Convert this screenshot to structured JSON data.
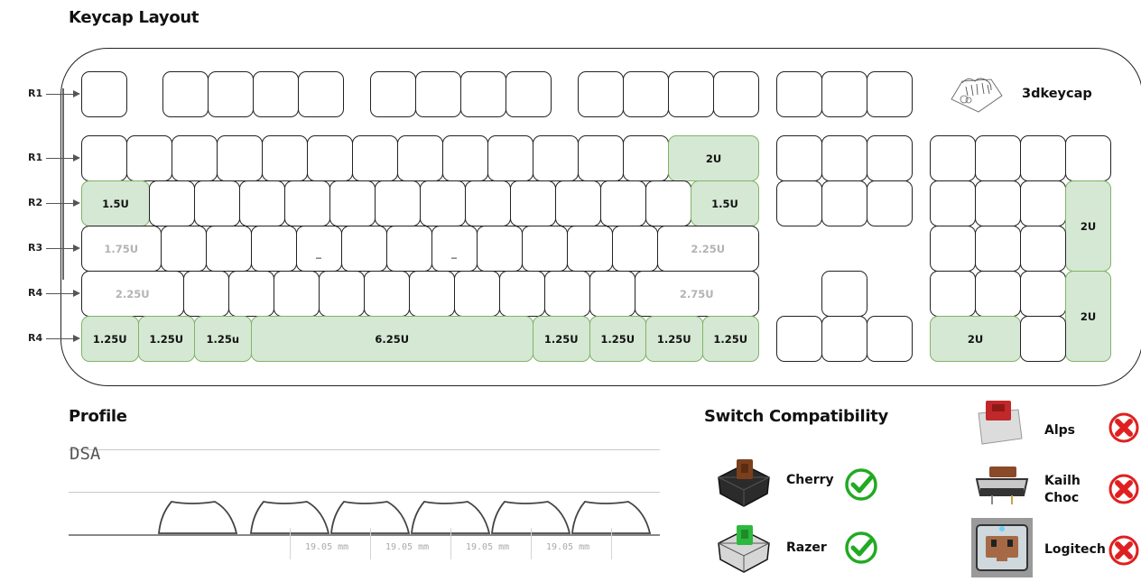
{
  "sections": {
    "layout_title": "Keycap Layout",
    "profile_title": "Profile",
    "switch_title": "Switch Compatibility"
  },
  "brand": {
    "name": "3dkeycap",
    "icon": "keycap-logo-icon"
  },
  "row_labels": [
    "R1",
    "R1",
    "R2",
    "R3",
    "R4",
    "R4"
  ],
  "keyboard": {
    "colors": {
      "highlight_fill": "#d5e8d4",
      "highlight_border": "#82b366",
      "dim_text": "#b3b3b3"
    },
    "rows": [
      {
        "row": "R1",
        "keys": [
          {
            "u": 1,
            "label": ""
          },
          {
            "gap": 0.8
          },
          {
            "u": 1,
            "label": ""
          },
          {
            "u": 1,
            "label": ""
          },
          {
            "u": 1,
            "label": ""
          },
          {
            "u": 1,
            "label": ""
          },
          {
            "gap": 0.6
          },
          {
            "u": 1,
            "label": ""
          },
          {
            "u": 1,
            "label": ""
          },
          {
            "u": 1,
            "label": ""
          },
          {
            "u": 1,
            "label": ""
          },
          {
            "gap": 0.6
          },
          {
            "u": 1,
            "label": ""
          },
          {
            "u": 1,
            "label": ""
          },
          {
            "u": 1,
            "label": ""
          },
          {
            "u": 1,
            "label": ""
          }
        ]
      },
      {
        "row": "R1",
        "keys": [
          {
            "u": 1,
            "label": ""
          },
          {
            "u": 1,
            "label": ""
          },
          {
            "u": 1,
            "label": ""
          },
          {
            "u": 1,
            "label": ""
          },
          {
            "u": 1,
            "label": ""
          },
          {
            "u": 1,
            "label": ""
          },
          {
            "u": 1,
            "label": ""
          },
          {
            "u": 1,
            "label": ""
          },
          {
            "u": 1,
            "label": ""
          },
          {
            "u": 1,
            "label": ""
          },
          {
            "u": 1,
            "label": ""
          },
          {
            "u": 1,
            "label": ""
          },
          {
            "u": 1,
            "label": ""
          },
          {
            "u": 2,
            "label": "2U",
            "hl": true
          }
        ]
      },
      {
        "row": "R2",
        "keys": [
          {
            "u": 1.5,
            "label": "1.5U",
            "hl": true
          },
          {
            "u": 1,
            "label": ""
          },
          {
            "u": 1,
            "label": ""
          },
          {
            "u": 1,
            "label": ""
          },
          {
            "u": 1,
            "label": ""
          },
          {
            "u": 1,
            "label": ""
          },
          {
            "u": 1,
            "label": ""
          },
          {
            "u": 1,
            "label": ""
          },
          {
            "u": 1,
            "label": ""
          },
          {
            "u": 1,
            "label": ""
          },
          {
            "u": 1,
            "label": ""
          },
          {
            "u": 1,
            "label": ""
          },
          {
            "u": 1,
            "label": ""
          },
          {
            "u": 1.5,
            "label": "1.5U",
            "hl": true
          }
        ]
      },
      {
        "row": "R3",
        "keys": [
          {
            "u": 1.75,
            "label": "1.75U",
            "dim": true
          },
          {
            "u": 1,
            "label": ""
          },
          {
            "u": 1,
            "label": ""
          },
          {
            "u": 1,
            "label": ""
          },
          {
            "u": 1,
            "label": "_"
          },
          {
            "u": 1,
            "label": ""
          },
          {
            "u": 1,
            "label": ""
          },
          {
            "u": 1,
            "label": "_"
          },
          {
            "u": 1,
            "label": ""
          },
          {
            "u": 1,
            "label": ""
          },
          {
            "u": 1,
            "label": ""
          },
          {
            "u": 1,
            "label": ""
          },
          {
            "u": 2.25,
            "label": "2.25U",
            "dim": true
          }
        ]
      },
      {
        "row": "R4",
        "keys": [
          {
            "u": 2.25,
            "label": "2.25U",
            "dim": true
          },
          {
            "u": 1,
            "label": ""
          },
          {
            "u": 1,
            "label": ""
          },
          {
            "u": 1,
            "label": ""
          },
          {
            "u": 1,
            "label": ""
          },
          {
            "u": 1,
            "label": ""
          },
          {
            "u": 1,
            "label": ""
          },
          {
            "u": 1,
            "label": ""
          },
          {
            "u": 1,
            "label": ""
          },
          {
            "u": 1,
            "label": ""
          },
          {
            "u": 1,
            "label": ""
          },
          {
            "u": 2.75,
            "label": "2.75U",
            "dim": true
          }
        ]
      },
      {
        "row": "R4",
        "keys": [
          {
            "u": 1.25,
            "label": "1.25U",
            "hl": true
          },
          {
            "u": 1.25,
            "label": "1.25U",
            "hl": true
          },
          {
            "u": 1.25,
            "label": "1.25u",
            "hl": true
          },
          {
            "u": 6.25,
            "label": "6.25U",
            "hl": true
          },
          {
            "u": 1.25,
            "label": "1.25U",
            "hl": true
          },
          {
            "u": 1.25,
            "label": "1.25U",
            "hl": true
          },
          {
            "u": 1.25,
            "label": "1.25U",
            "hl": true
          },
          {
            "u": 1.25,
            "label": "1.25U",
            "hl": true
          }
        ]
      }
    ],
    "nav_cluster": [
      {
        "col": 0,
        "row": 0,
        "label": ""
      },
      {
        "col": 1,
        "row": 0,
        "label": ""
      },
      {
        "col": 2,
        "row": 0,
        "label": ""
      },
      {
        "col": 0,
        "row": 1,
        "label": ""
      },
      {
        "col": 1,
        "row": 1,
        "label": ""
      },
      {
        "col": 2,
        "row": 1,
        "label": ""
      },
      {
        "col": 0,
        "row": 2,
        "label": ""
      },
      {
        "col": 1,
        "row": 2,
        "label": ""
      },
      {
        "col": 2,
        "row": 2,
        "label": ""
      },
      {
        "col": 1,
        "row": 4,
        "label": ""
      },
      {
        "col": 0,
        "row": 5,
        "label": ""
      },
      {
        "col": 1,
        "row": 5,
        "label": ""
      },
      {
        "col": 2,
        "row": 5,
        "label": ""
      }
    ],
    "numpad": [
      {
        "col": 0,
        "row": 1,
        "w": 1,
        "h": 1,
        "label": ""
      },
      {
        "col": 1,
        "row": 1,
        "w": 1,
        "h": 1,
        "label": ""
      },
      {
        "col": 2,
        "row": 1,
        "w": 1,
        "h": 1,
        "label": ""
      },
      {
        "col": 3,
        "row": 1,
        "w": 1,
        "h": 1,
        "label": ""
      },
      {
        "col": 0,
        "row": 2,
        "w": 1,
        "h": 1,
        "label": ""
      },
      {
        "col": 1,
        "row": 2,
        "w": 1,
        "h": 1,
        "label": ""
      },
      {
        "col": 2,
        "row": 2,
        "w": 1,
        "h": 1,
        "label": ""
      },
      {
        "col": 3,
        "row": 2,
        "w": 1,
        "h": 2,
        "label": "2U",
        "hl": true
      },
      {
        "col": 0,
        "row": 3,
        "w": 1,
        "h": 1,
        "label": ""
      },
      {
        "col": 1,
        "row": 3,
        "w": 1,
        "h": 1,
        "label": ""
      },
      {
        "col": 2,
        "row": 3,
        "w": 1,
        "h": 1,
        "label": ""
      },
      {
        "col": 0,
        "row": 4,
        "w": 1,
        "h": 1,
        "label": ""
      },
      {
        "col": 1,
        "row": 4,
        "w": 1,
        "h": 1,
        "label": ""
      },
      {
        "col": 2,
        "row": 4,
        "w": 1,
        "h": 1,
        "label": ""
      },
      {
        "col": 3,
        "row": 4,
        "w": 1,
        "h": 2,
        "label": "2U",
        "hl": true
      },
      {
        "col": 0,
        "row": 5,
        "w": 2,
        "h": 1,
        "label": "2U",
        "hl": true
      },
      {
        "col": 2,
        "row": 5,
        "w": 1,
        "h": 1,
        "label": ""
      }
    ]
  },
  "profile": {
    "name": "DSA",
    "keycap_count": 6,
    "spacing_labels": [
      "19.05 mm",
      "19.05 mm",
      "19.05 mm",
      "19.05 mm"
    ]
  },
  "switches": {
    "compatible_color": "#22aa22",
    "incompatible_color": "#e02020",
    "items": [
      {
        "name": "Cherry",
        "compatible": true,
        "stem_color": "#7a3f1c",
        "housing_color": "#2b2b2b"
      },
      {
        "name": "Razer",
        "compatible": true,
        "stem_color": "#2db83d",
        "housing_color": "#d6d6d6"
      },
      {
        "name": "Alps",
        "compatible": false,
        "stem_color": "#c0282a",
        "housing_color": "#dcdcdc"
      },
      {
        "name": "Kailh Choc",
        "name_lines": [
          "Kailh",
          "Choc"
        ],
        "compatible": false,
        "stem_color": "#8a4a28",
        "housing_color": "#333333"
      },
      {
        "name": "Logitech",
        "compatible": false,
        "stem_color": "#a56a45",
        "housing_color": "#666666"
      }
    ]
  }
}
